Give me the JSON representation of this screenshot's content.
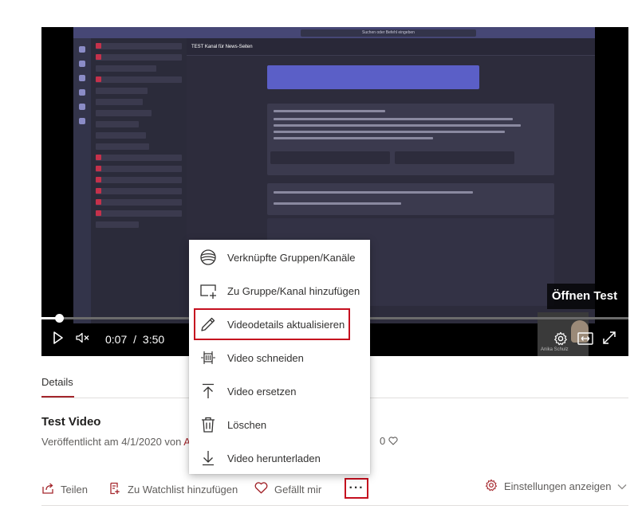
{
  "video_frame": {
    "search_placeholder": "Suchen oder Befehl eingeben",
    "channel_title": "TEST Kanal für News-Seiten"
  },
  "player": {
    "open_overlay": "Öffnen Test",
    "time_current": "0:07",
    "time_separator": "/",
    "time_total": "3:50",
    "progress_fraction": 0.03,
    "presenter_name": "Anika Schulz",
    "icons": [
      "play-icon",
      "mute-icon",
      "settings-gear-icon",
      "theater-mode-icon",
      "fullscreen-icon"
    ]
  },
  "details": {
    "tab_label": "Details",
    "title": "Test Video",
    "published_prefix": "Veröffentlicht am 4/1/2020 von",
    "author_fragment": "Ar",
    "like_count": "0"
  },
  "actions": {
    "share_label": "Teilen",
    "watchlist_label": "Zu Watchlist hinzufügen",
    "like_label": "Gefällt mir",
    "more_label": "···",
    "settings_label": "Einstellungen anzeigen"
  },
  "menu": {
    "items": [
      {
        "label": "Verknüpfte Gruppen/Kanäle",
        "icon": "linked-groups-icon"
      },
      {
        "label": "Zu Gruppe/Kanal hinzufügen",
        "icon": "add-to-group-icon"
      },
      {
        "label": "Videodetails aktualisieren",
        "icon": "pencil-icon"
      },
      {
        "label": "Video schneiden",
        "icon": "trim-icon"
      },
      {
        "label": "Video ersetzen",
        "icon": "replace-upload-icon"
      },
      {
        "label": "Löschen",
        "icon": "trash-icon"
      },
      {
        "label": "Video herunterladen",
        "icon": "download-icon"
      }
    ]
  },
  "colors": {
    "accent": "#a4262c",
    "highlight_border": "#c50f1f",
    "teams_header": "#464775"
  }
}
